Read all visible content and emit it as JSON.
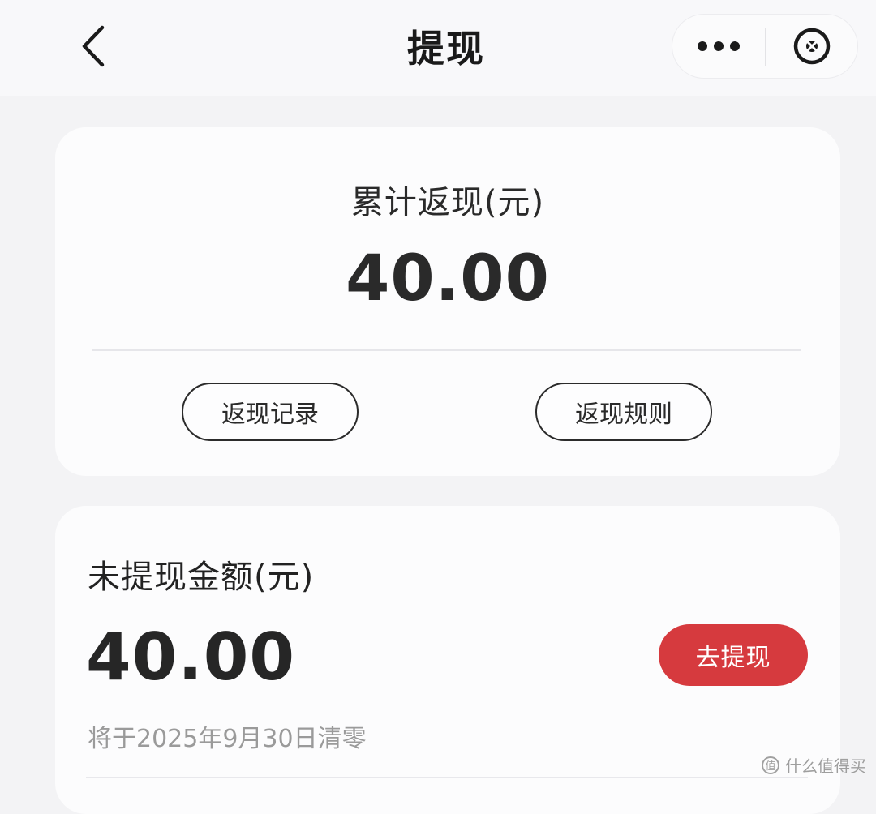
{
  "navbar": {
    "title": "提现",
    "back_icon": "chevron-left-icon",
    "more_icon": "more-dots-icon",
    "close_icon": "close-circle-icon"
  },
  "summary": {
    "label": "累计返现(元)",
    "amount": "40.00",
    "records_button": "返现记录",
    "rules_button": "返现规则"
  },
  "withdraw": {
    "label": "未提现金额(元)",
    "amount": "40.00",
    "button": "去提现",
    "note": "将于2025年9月30日清零"
  },
  "watermark": {
    "text": "什么值得买",
    "icon": "smzdm-logo-icon"
  },
  "colors": {
    "accent": "#d63a3e",
    "background": "#f3f3f5",
    "card": "#fcfcfd"
  }
}
